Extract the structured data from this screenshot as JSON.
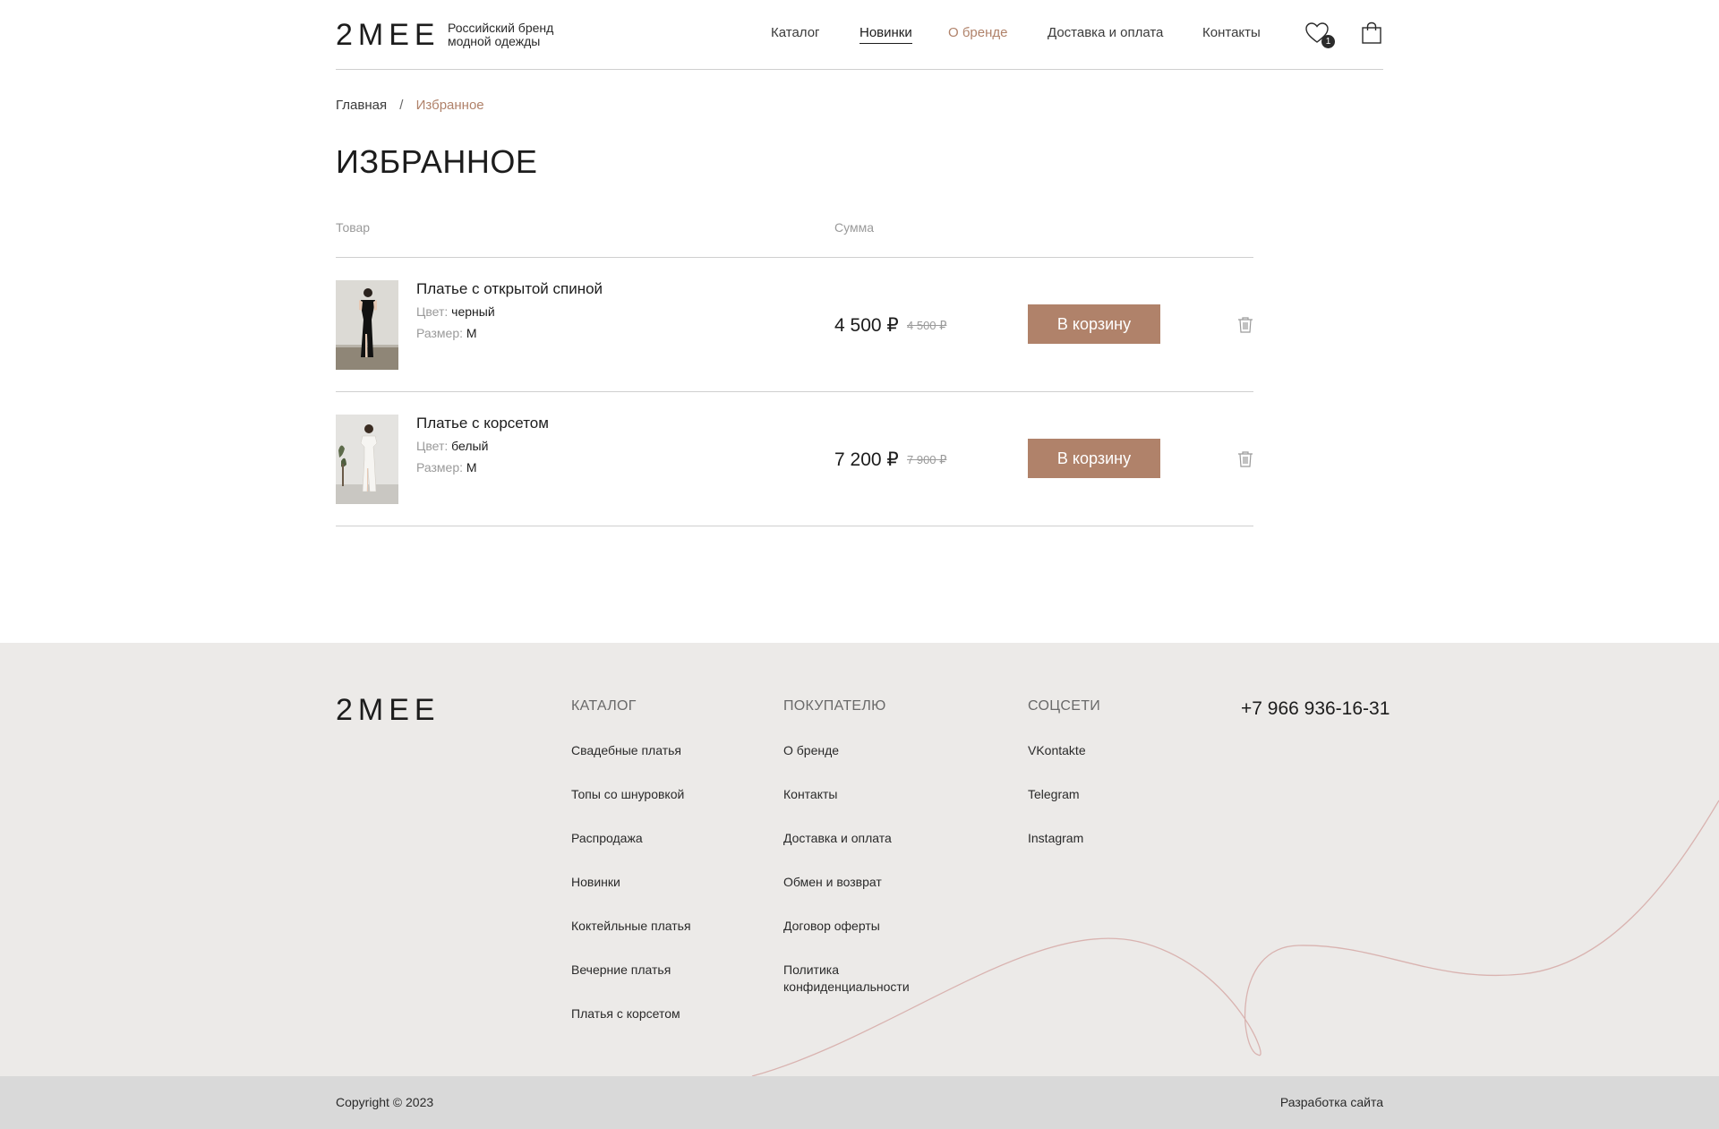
{
  "header": {
    "logo": "2MEE",
    "tagline_line1": "Российский бренд",
    "tagline_line2": "модной одежды",
    "nav": [
      "Каталог",
      "Новинки",
      "О бренде",
      "Доставка и оплата",
      "Контакты"
    ],
    "favorites_count": "1",
    "accent_color": "#b0826a"
  },
  "breadcrumb": {
    "home": "Главная",
    "sep": "/",
    "current": "Избранное"
  },
  "page_title": "ИЗБРАННОЕ",
  "table": {
    "col_product": "Товар",
    "col_sum": "Сумма",
    "items": [
      {
        "name": "Платье с открытой спиной",
        "color_label": "Цвет:",
        "color": "черный",
        "size_label": "Размер:",
        "size": "M",
        "price": "4 500 ₽",
        "old_price": "4 500 ₽",
        "button": "В корзину"
      },
      {
        "name": "Платье с корсетом",
        "color_label": "Цвет:",
        "color": "белый",
        "size_label": "Размер:",
        "size": "M",
        "price": "7 200 ₽",
        "old_price": "7 900 ₽",
        "button": "В корзину"
      }
    ]
  },
  "footer": {
    "logo": "2MEE",
    "catalog": {
      "title": "КАТАЛОГ",
      "links": [
        "Свадебные платья",
        "Топы со шнуровкой",
        "Распродажа",
        "Новинки",
        "Коктейльные платья",
        "Вечерние платья",
        "Платья с корсетом"
      ]
    },
    "buyer": {
      "title": "ПОКУПАТЕЛЮ",
      "links": [
        "О бренде",
        "Контакты",
        "Доставка и оплата",
        "Обмен и возврат",
        "Договор оферты",
        "Политика конфиденциальности"
      ]
    },
    "social": {
      "title": "СОЦСЕТИ",
      "links": [
        "VKontakte",
        "Telegram",
        "Instagram"
      ]
    },
    "phone": "+7 966 936-16-31",
    "copyright": "Copyright © 2023",
    "dev": "Разработка сайта"
  }
}
